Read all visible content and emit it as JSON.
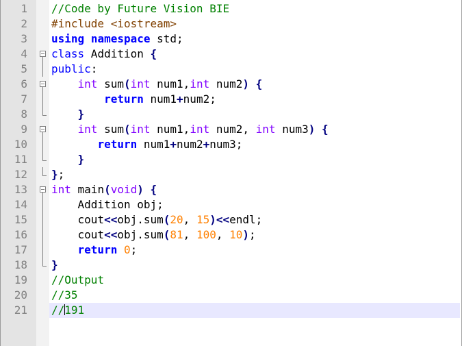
{
  "editor": {
    "current_line": 21,
    "lines": [
      {
        "n": "1",
        "t": [
          [
            "cm",
            "//Code by Future Vision BIE"
          ]
        ]
      },
      {
        "n": "2",
        "t": [
          [
            "pp",
            "#include <iostream>"
          ]
        ]
      },
      {
        "n": "3",
        "t": [
          [
            "kwb",
            "using"
          ],
          [
            "",
            " "
          ],
          [
            "kwb",
            "namespace"
          ],
          [
            "",
            " std;"
          ]
        ]
      },
      {
        "n": "4",
        "t": [
          [
            "kw",
            "class"
          ],
          [
            "",
            " Addition "
          ],
          [
            "op",
            "{"
          ]
        ]
      },
      {
        "n": "5",
        "t": [
          [
            "kw",
            "public"
          ],
          [
            "",
            ":"
          ]
        ]
      },
      {
        "n": "6",
        "t": [
          [
            "",
            "    "
          ],
          [
            "tp",
            "int"
          ],
          [
            "",
            " sum"
          ],
          [
            "op",
            "("
          ],
          [
            "tp",
            "int"
          ],
          [
            "",
            " num1,"
          ],
          [
            "tp",
            "int"
          ],
          [
            "",
            " num2"
          ],
          [
            "op",
            ")"
          ],
          [
            "",
            " "
          ],
          [
            "op",
            "{"
          ]
        ]
      },
      {
        "n": "7",
        "t": [
          [
            "",
            "        "
          ],
          [
            "kwb",
            "return"
          ],
          [
            "",
            " num1"
          ],
          [
            "op",
            "+"
          ],
          [
            "",
            "num2;"
          ]
        ]
      },
      {
        "n": "8",
        "t": [
          [
            "",
            "    "
          ],
          [
            "op",
            "}"
          ]
        ]
      },
      {
        "n": "9",
        "t": [
          [
            "",
            "    "
          ],
          [
            "tp",
            "int"
          ],
          [
            "",
            " sum"
          ],
          [
            "op",
            "("
          ],
          [
            "tp",
            "int"
          ],
          [
            "",
            " num1,"
          ],
          [
            "tp",
            "int"
          ],
          [
            "",
            " num2, "
          ],
          [
            "tp",
            "int"
          ],
          [
            "",
            " num3"
          ],
          [
            "op",
            ")"
          ],
          [
            "",
            " "
          ],
          [
            "op",
            "{"
          ]
        ]
      },
      {
        "n": "10",
        "t": [
          [
            "",
            "       "
          ],
          [
            "kwb",
            "return"
          ],
          [
            "",
            " num1"
          ],
          [
            "op",
            "+"
          ],
          [
            "",
            "num2"
          ],
          [
            "op",
            "+"
          ],
          [
            "",
            "num3;"
          ]
        ]
      },
      {
        "n": "11",
        "t": [
          [
            "",
            "    "
          ],
          [
            "op",
            "}"
          ]
        ]
      },
      {
        "n": "12",
        "t": [
          [
            "op",
            "}"
          ],
          [
            "",
            ";"
          ]
        ]
      },
      {
        "n": "13",
        "t": [
          [
            "tp",
            "int"
          ],
          [
            "",
            " main"
          ],
          [
            "op",
            "("
          ],
          [
            "tp",
            "void"
          ],
          [
            "op",
            ")"
          ],
          [
            "",
            " "
          ],
          [
            "op",
            "{"
          ]
        ]
      },
      {
        "n": "14",
        "t": [
          [
            "",
            "    Addition obj;"
          ]
        ]
      },
      {
        "n": "15",
        "t": [
          [
            "",
            "    cout"
          ],
          [
            "op",
            "<<"
          ],
          [
            "",
            "obj.sum"
          ],
          [
            "op",
            "("
          ],
          [
            "num",
            "20"
          ],
          [
            "",
            ", "
          ],
          [
            "num",
            "15"
          ],
          [
            "op",
            ")<<"
          ],
          [
            "",
            "endl;"
          ]
        ]
      },
      {
        "n": "16",
        "t": [
          [
            "",
            "    cout"
          ],
          [
            "op",
            "<<"
          ],
          [
            "",
            "obj.sum"
          ],
          [
            "op",
            "("
          ],
          [
            "num",
            "81"
          ],
          [
            "",
            ", "
          ],
          [
            "num",
            "100"
          ],
          [
            "",
            ", "
          ],
          [
            "num",
            "10"
          ],
          [
            "op",
            ")"
          ],
          [
            "",
            ";"
          ]
        ]
      },
      {
        "n": "17",
        "t": [
          [
            "",
            "    "
          ],
          [
            "kwb",
            "return"
          ],
          [
            "",
            " "
          ],
          [
            "num",
            "0"
          ],
          [
            "",
            ";"
          ]
        ]
      },
      {
        "n": "18",
        "t": [
          [
            "op",
            "}"
          ]
        ]
      },
      {
        "n": "19",
        "t": [
          [
            "cm",
            "//Output"
          ]
        ]
      },
      {
        "n": "20",
        "t": [
          [
            "cm",
            "//35"
          ]
        ]
      },
      {
        "n": "21",
        "t": [
          [
            "cm",
            "//"
          ],
          [
            "caret",
            ""
          ],
          [
            "cm",
            "191"
          ]
        ]
      }
    ],
    "fold": {
      "4": "box",
      "5": "line",
      "6": "box",
      "7": "line",
      "8": "end",
      "9": "box",
      "10": "line",
      "11": "end",
      "12": "end",
      "13": "box",
      "14": "line",
      "15": "line",
      "16": "line",
      "17": "line",
      "18": "end"
    }
  }
}
